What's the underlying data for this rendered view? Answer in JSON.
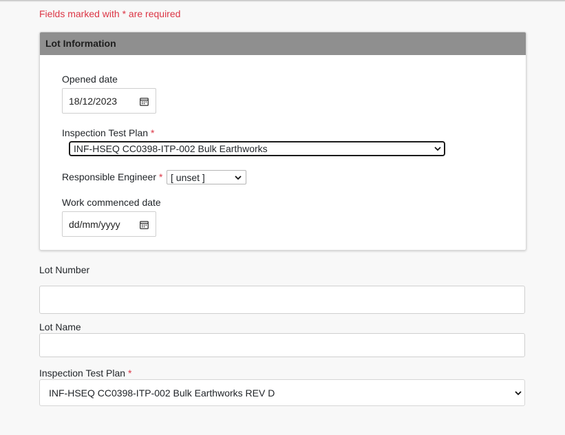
{
  "form": {
    "required_note": "Fields marked with * are required",
    "required_marker": "*"
  },
  "lot_information": {
    "header": "Lot Information",
    "opened_date": {
      "label": "Opened date",
      "value": "18/12/2023",
      "icon": "calendar-icon"
    },
    "inspection_test_plan": {
      "label": "Inspection Test Plan",
      "selected": "INF-HSEQ CC0398-ITP-002 Bulk Earthworks",
      "icon": "chevron-down-icon"
    },
    "responsible_engineer": {
      "label": "Responsible Engineer",
      "selected": "[ unset ]",
      "icon": "chevron-down-icon"
    },
    "work_commenced_date": {
      "label": "Work commenced date",
      "placeholder": "dd/mm/yyyy",
      "icon": "calendar-icon"
    }
  },
  "lot_number": {
    "label": "Lot Number",
    "value": ""
  },
  "lot_name": {
    "label": "Lot Name",
    "value": ""
  },
  "inspection_test_plan_main": {
    "label": "Inspection Test Plan",
    "selected": "INF-HSEQ CC0398-ITP-002 Bulk Earthworks REV D",
    "icon": "chevron-down-icon"
  }
}
